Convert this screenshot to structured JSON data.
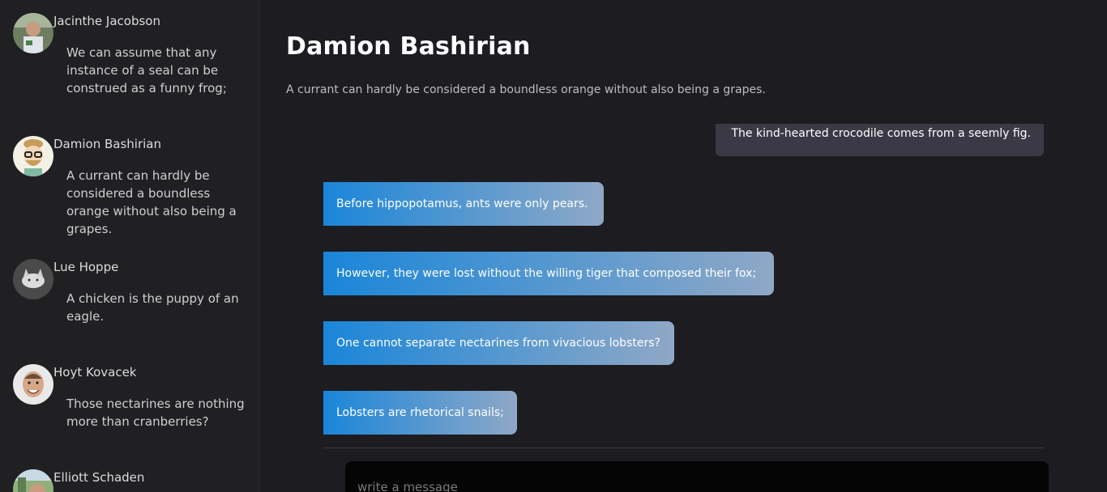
{
  "contacts": [
    {
      "name": "Jacinthe Jacobson",
      "preview": "We can assume that any instance of a seal can be construed as a funny frog;"
    },
    {
      "name": "Damion Bashirian",
      "preview": "A currant can hardly be considered a boundless orange without also being a grapes."
    },
    {
      "name": "Lue Hoppe",
      "preview": "A chicken is the puppy of an eagle."
    },
    {
      "name": "Hoyt Kovacek",
      "preview": "Those nectarines are nothing more than cranberries?"
    },
    {
      "name": "Elliott Schaden",
      "preview": ""
    }
  ],
  "chat": {
    "title": "Damion Bashirian",
    "subtitle": "A currant can hardly be considered a boundless orange without also being a grapes.",
    "messages": [
      {
        "direction": "outgoing",
        "text": "The kind-hearted crocodile comes from a seemly fig."
      },
      {
        "direction": "incoming",
        "text": "Before hippopotamus, ants were only pears."
      },
      {
        "direction": "incoming",
        "text": "However, they were lost without the willing tiger that composed their fox;"
      },
      {
        "direction": "incoming",
        "text": "One cannot separate nectarines from vivacious lobsters?"
      },
      {
        "direction": "incoming",
        "text": "Lobsters are rhetorical snails;"
      }
    ]
  },
  "composer": {
    "placeholder": "write a message",
    "value": ""
  },
  "colors": {
    "background": "#1d1c20",
    "sidebar": "#202023",
    "outgoing_bubble": "#3a3945",
    "incoming_gradient_start": "#1a86d9",
    "incoming_gradient_end": "#8fa8c6",
    "composer": "#050505"
  }
}
